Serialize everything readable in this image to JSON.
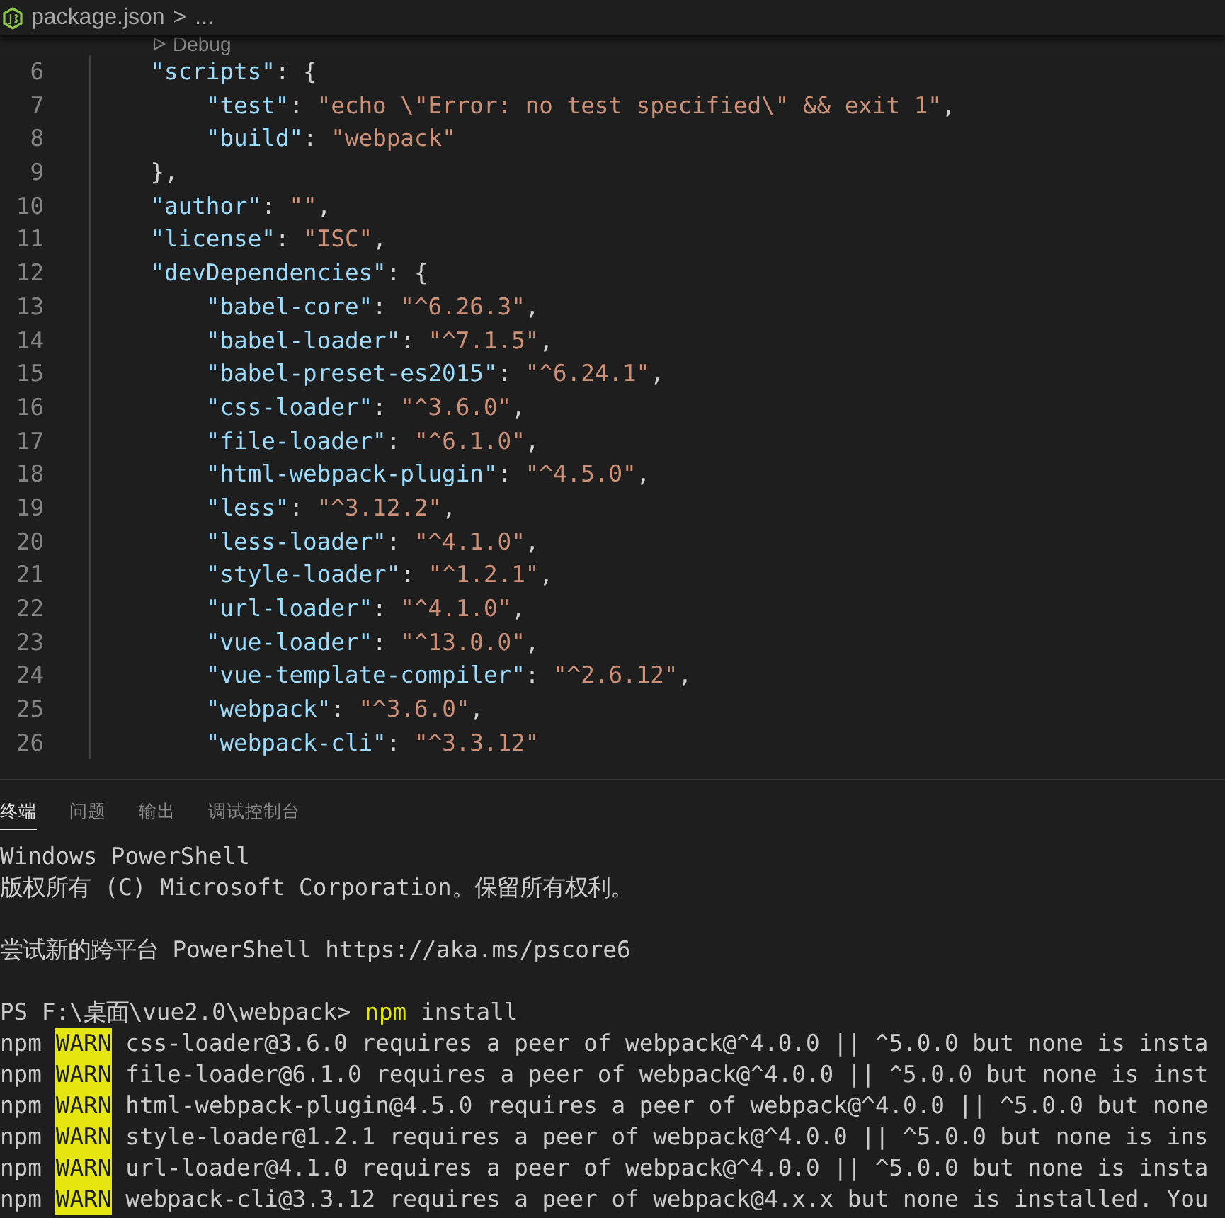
{
  "breadcrumb": {
    "file": "package.json",
    "separator": ">",
    "rest": "..."
  },
  "codelens": {
    "label": "Debug"
  },
  "code_lines": [
    {
      "number": "6",
      "tokens": [
        {
          "kind": "key",
          "text": "    \"scripts\""
        },
        {
          "kind": "punct",
          "text": ": {"
        }
      ]
    },
    {
      "number": "7",
      "tokens": [
        {
          "kind": "key",
          "text": "        \"test\""
        },
        {
          "kind": "punct",
          "text": ": "
        },
        {
          "kind": "string",
          "text": "\"echo \\\"Error: no test specified\\\" && exit 1\""
        },
        {
          "kind": "punct",
          "text": ","
        }
      ]
    },
    {
      "number": "8",
      "tokens": [
        {
          "kind": "key",
          "text": "        \"build\""
        },
        {
          "kind": "punct",
          "text": ": "
        },
        {
          "kind": "string",
          "text": "\"webpack\""
        }
      ]
    },
    {
      "number": "9",
      "tokens": [
        {
          "kind": "punct",
          "text": "    },"
        }
      ]
    },
    {
      "number": "10",
      "tokens": [
        {
          "kind": "key",
          "text": "    \"author\""
        },
        {
          "kind": "punct",
          "text": ": "
        },
        {
          "kind": "string",
          "text": "\"\""
        },
        {
          "kind": "punct",
          "text": ","
        }
      ]
    },
    {
      "number": "11",
      "tokens": [
        {
          "kind": "key",
          "text": "    \"license\""
        },
        {
          "kind": "punct",
          "text": ": "
        },
        {
          "kind": "string",
          "text": "\"ISC\""
        },
        {
          "kind": "punct",
          "text": ","
        }
      ]
    },
    {
      "number": "12",
      "tokens": [
        {
          "kind": "key",
          "text": "    \"devDependencies\""
        },
        {
          "kind": "punct",
          "text": ": {"
        }
      ]
    },
    {
      "number": "13",
      "tokens": [
        {
          "kind": "key",
          "text": "        \"babel-core\""
        },
        {
          "kind": "punct",
          "text": ": "
        },
        {
          "kind": "string",
          "text": "\"^6.26.3\""
        },
        {
          "kind": "punct",
          "text": ","
        }
      ]
    },
    {
      "number": "14",
      "tokens": [
        {
          "kind": "key",
          "text": "        \"babel-loader\""
        },
        {
          "kind": "punct",
          "text": ": "
        },
        {
          "kind": "string",
          "text": "\"^7.1.5\""
        },
        {
          "kind": "punct",
          "text": ","
        }
      ]
    },
    {
      "number": "15",
      "tokens": [
        {
          "kind": "key",
          "text": "        \"babel-preset-es2015\""
        },
        {
          "kind": "punct",
          "text": ": "
        },
        {
          "kind": "string",
          "text": "\"^6.24.1\""
        },
        {
          "kind": "punct",
          "text": ","
        }
      ]
    },
    {
      "number": "16",
      "tokens": [
        {
          "kind": "key",
          "text": "        \"css-loader\""
        },
        {
          "kind": "punct",
          "text": ": "
        },
        {
          "kind": "string",
          "text": "\"^3.6.0\""
        },
        {
          "kind": "punct",
          "text": ","
        }
      ]
    },
    {
      "number": "17",
      "tokens": [
        {
          "kind": "key",
          "text": "        \"file-loader\""
        },
        {
          "kind": "punct",
          "text": ": "
        },
        {
          "kind": "string",
          "text": "\"^6.1.0\""
        },
        {
          "kind": "punct",
          "text": ","
        }
      ]
    },
    {
      "number": "18",
      "tokens": [
        {
          "kind": "key",
          "text": "        \"html-webpack-plugin\""
        },
        {
          "kind": "punct",
          "text": ": "
        },
        {
          "kind": "string",
          "text": "\"^4.5.0\""
        },
        {
          "kind": "punct",
          "text": ","
        }
      ]
    },
    {
      "number": "19",
      "tokens": [
        {
          "kind": "key",
          "text": "        \"less\""
        },
        {
          "kind": "punct",
          "text": ": "
        },
        {
          "kind": "string",
          "text": "\"^3.12.2\""
        },
        {
          "kind": "punct",
          "text": ","
        }
      ]
    },
    {
      "number": "20",
      "tokens": [
        {
          "kind": "key",
          "text": "        \"less-loader\""
        },
        {
          "kind": "punct",
          "text": ": "
        },
        {
          "kind": "string",
          "text": "\"^4.1.0\""
        },
        {
          "kind": "punct",
          "text": ","
        }
      ]
    },
    {
      "number": "21",
      "tokens": [
        {
          "kind": "key",
          "text": "        \"style-loader\""
        },
        {
          "kind": "punct",
          "text": ": "
        },
        {
          "kind": "string",
          "text": "\"^1.2.1\""
        },
        {
          "kind": "punct",
          "text": ","
        }
      ]
    },
    {
      "number": "22",
      "tokens": [
        {
          "kind": "key",
          "text": "        \"url-loader\""
        },
        {
          "kind": "punct",
          "text": ": "
        },
        {
          "kind": "string",
          "text": "\"^4.1.0\""
        },
        {
          "kind": "punct",
          "text": ","
        }
      ]
    },
    {
      "number": "23",
      "tokens": [
        {
          "kind": "key",
          "text": "        \"vue-loader\""
        },
        {
          "kind": "punct",
          "text": ": "
        },
        {
          "kind": "string",
          "text": "\"^13.0.0\""
        },
        {
          "kind": "punct",
          "text": ","
        }
      ]
    },
    {
      "number": "24",
      "tokens": [
        {
          "kind": "key",
          "text": "        \"vue-template-compiler\""
        },
        {
          "kind": "punct",
          "text": ": "
        },
        {
          "kind": "string",
          "text": "\"^2.6.12\""
        },
        {
          "kind": "punct",
          "text": ","
        }
      ]
    },
    {
      "number": "25",
      "tokens": [
        {
          "kind": "key",
          "text": "        \"webpack\""
        },
        {
          "kind": "punct",
          "text": ": "
        },
        {
          "kind": "string",
          "text": "\"^3.6.0\""
        },
        {
          "kind": "punct",
          "text": ","
        }
      ]
    },
    {
      "number": "26",
      "tokens": [
        {
          "kind": "key",
          "text": "        \"webpack-cli\""
        },
        {
          "kind": "punct",
          "text": ": "
        },
        {
          "kind": "string",
          "text": "\"^3.3.12\""
        }
      ]
    }
  ],
  "panel_tabs": [
    {
      "label": "终端",
      "selected": true
    },
    {
      "label": "问题",
      "selected": false
    },
    {
      "label": "输出",
      "selected": false
    },
    {
      "label": "调试控制台",
      "selected": false
    }
  ],
  "terminal_lines": [
    {
      "kind": "text",
      "text": "Windows PowerShell"
    },
    {
      "kind": "text",
      "text": "版权所有 (C) Microsoft Corporation。保留所有权利。"
    },
    {
      "kind": "blank"
    },
    {
      "kind": "text",
      "text": "尝试新的跨平台 PowerShell https://aka.ms/pscore6"
    },
    {
      "kind": "blank"
    },
    {
      "kind": "prompt",
      "prompt": "PS F:\\桌面\\vue2.0\\webpack>",
      "command": "npm",
      "args": "install"
    },
    {
      "kind": "warn",
      "prefix": "npm",
      "level": "WARN",
      "text": "css-loader@3.6.0 requires a peer of webpack@^4.0.0 || ^5.0.0 but none is insta"
    },
    {
      "kind": "warn",
      "prefix": "npm",
      "level": "WARN",
      "text": "file-loader@6.1.0 requires a peer of webpack@^4.0.0 || ^5.0.0 but none is inst"
    },
    {
      "kind": "warn",
      "prefix": "npm",
      "level": "WARN",
      "text": "html-webpack-plugin@4.5.0 requires a peer of webpack@^4.0.0 || ^5.0.0 but none"
    },
    {
      "kind": "warn",
      "prefix": "npm",
      "level": "WARN",
      "text": "style-loader@1.2.1 requires a peer of webpack@^4.0.0 || ^5.0.0 but none is ins"
    },
    {
      "kind": "warn",
      "prefix": "npm",
      "level": "WARN",
      "text": "url-loader@4.1.0 requires a peer of webpack@^4.0.0 || ^5.0.0 but none is insta"
    },
    {
      "kind": "warn",
      "prefix": "npm",
      "level": "WARN",
      "text": "webpack-cli@3.3.12 requires a peer of webpack@4.x.x but none is installed. You"
    }
  ]
}
